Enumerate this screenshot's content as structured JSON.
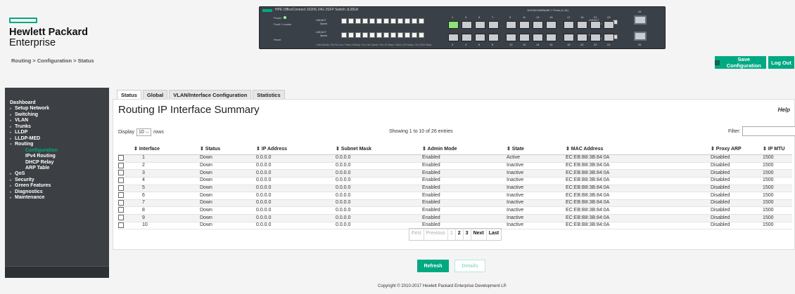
{
  "brand": {
    "line1": "Hewlett Packard",
    "line2": "Enterprise",
    "accent": "#01a982"
  },
  "device": {
    "title": "HPE OfficeConnect 1920S 24G 2SFP Switch JL381A",
    "ports_header": "10/100/1000BASE-T Ports (1-24)",
    "legend_power": "Power",
    "legend_fault": "Fault / Locator",
    "legend_reset": "Reset",
    "link_act": "LNK/ACT",
    "speed": "Speed",
    "footer": "Link/Activity: Off=No Link, Flash=Activity, On=Link     Speed: Off=10 Mbps, Flash=100 Mbps, On=1000 Mbps",
    "top_numbers": [
      "1",
      "3",
      "5",
      "7",
      "9",
      "11",
      "13",
      "15",
      "17",
      "19",
      "21",
      "23"
    ],
    "bottom_numbers": [
      "2",
      "4",
      "6",
      "8",
      "10",
      "12",
      "14",
      "16",
      "18",
      "20",
      "22",
      "24"
    ],
    "sfp_top": "25",
    "sfp_bottom": "26"
  },
  "breadcrumb": "Routing > Configuration > Status",
  "header_buttons": {
    "save": "Save Configuration",
    "logout": "Log Out"
  },
  "sidebar": {
    "items": [
      {
        "label": "Dashboard",
        "arrow": ""
      },
      {
        "label": "Setup Network",
        "arrow": "▸"
      },
      {
        "label": "Switching",
        "arrow": "▸"
      },
      {
        "label": "VLAN",
        "arrow": "▸"
      },
      {
        "label": "Trunks",
        "arrow": "▸"
      },
      {
        "label": "LLDP",
        "arrow": "▸"
      },
      {
        "label": "LLDP-MED",
        "arrow": "▸"
      },
      {
        "label": "Routing",
        "arrow": "▾"
      }
    ],
    "sub_items": [
      "Configuration",
      "IPv4 Routing",
      "DHCP Relay",
      "ARP Table"
    ],
    "items_after": [
      {
        "label": "QoS",
        "arrow": "▸"
      },
      {
        "label": "Security",
        "arrow": "▸"
      },
      {
        "label": "Green Features",
        "arrow": "▸"
      },
      {
        "label": "Diagnostics",
        "arrow": "▸"
      },
      {
        "label": "Maintenance",
        "arrow": "▸"
      }
    ]
  },
  "tabs": [
    "Status",
    "Global",
    "VLAN/Interface Configuration",
    "Statistics"
  ],
  "main": {
    "title": "Routing IP Interface Summary",
    "help": "Help",
    "display_label": "Display",
    "rows_value": "10",
    "rows_label": "rows",
    "showing": "Showing 1 to 10 of 26 entries",
    "filter_label": "Filter:"
  },
  "table": {
    "columns": [
      "⇕ Interface",
      "⇕ Status",
      "⇕ IP Address",
      "⇕ Subnet Mask",
      "⇕ Admin Mode",
      "⇕ State",
      "⇕ MAC Address",
      "⇕ Proxy ARP",
      "⇕ IP MTU"
    ],
    "rows": [
      [
        "1",
        "Down",
        "0.0.0.0",
        "0.0.0.0",
        "Enabled",
        "Active",
        "EC:EB:B8:3B:84:0A",
        "Disabled",
        "1500"
      ],
      [
        "2",
        "Down",
        "0.0.0.0",
        "0.0.0.0",
        "Enabled",
        "Inactive",
        "EC:EB:B8:3B:84:0A",
        "Disabled",
        "1500"
      ],
      [
        "3",
        "Down",
        "0.0.0.0",
        "0.0.0.0",
        "Enabled",
        "Inactive",
        "EC:EB:B8:3B:84:0A",
        "Disabled",
        "1500"
      ],
      [
        "4",
        "Down",
        "0.0.0.0",
        "0.0.0.0",
        "Enabled",
        "Inactive",
        "EC:EB:B8:3B:84:0A",
        "Disabled",
        "1500"
      ],
      [
        "5",
        "Down",
        "0.0.0.0",
        "0.0.0.0",
        "Enabled",
        "Inactive",
        "EC:EB:B8:3B:84:0A",
        "Disabled",
        "1500"
      ],
      [
        "6",
        "Down",
        "0.0.0.0",
        "0.0.0.0",
        "Enabled",
        "Inactive",
        "EC:EB:B8:3B:84:0A",
        "Disabled",
        "1500"
      ],
      [
        "7",
        "Down",
        "0.0.0.0",
        "0.0.0.0",
        "Enabled",
        "Inactive",
        "EC:EB:B8:3B:84:0A",
        "Disabled",
        "1500"
      ],
      [
        "8",
        "Down",
        "0.0.0.0",
        "0.0.0.0",
        "Enabled",
        "Inactive",
        "EC:EB:B8:3B:84:0A",
        "Disabled",
        "1500"
      ],
      [
        "9",
        "Down",
        "0.0.0.0",
        "0.0.0.0",
        "Enabled",
        "Inactive",
        "EC:EB:B8:3B:84:0A",
        "Disabled",
        "1500"
      ],
      [
        "10",
        "Down",
        "0.0.0.0",
        "0.0.0.0",
        "Enabled",
        "Inactive",
        "EC:EB:B8:3B:84:0A",
        "Disabled",
        "1500"
      ]
    ]
  },
  "pager": {
    "first": "First",
    "previous": "Previous",
    "pages": [
      "1",
      "2",
      "3"
    ],
    "next": "Next",
    "last": "Last"
  },
  "actions": {
    "refresh": "Refresh",
    "details": "Details"
  },
  "footer": "Copyright © 2010-2017 Hewlett Packard Enterprise Development LP."
}
